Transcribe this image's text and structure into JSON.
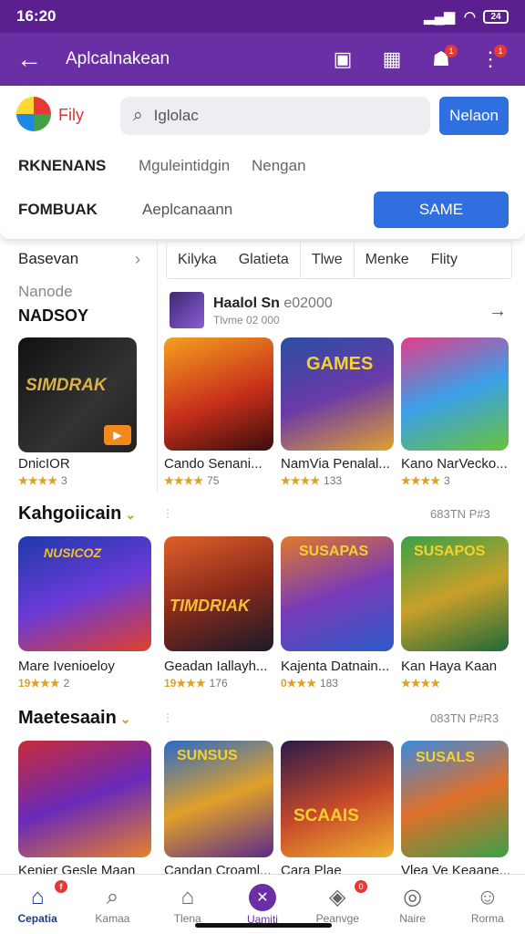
{
  "status": {
    "time": "16:20",
    "battery": "24"
  },
  "appbar": {
    "title": "Aplcalnakean",
    "badge1": "1",
    "badge2": "1"
  },
  "header": {
    "brand": "Fily",
    "search_placeholder": "Iglolac",
    "search_button": "Nelaon",
    "row1_label": "RKNENANS",
    "row1_text": "Mguleintidgin",
    "row1_text2": "Nengan",
    "row2_label": "FOMBUAK",
    "row2_placeholder": "Aeplcanaann",
    "row2_button": "SAME"
  },
  "sidebar": {
    "heading": "Basevan",
    "subtitle": "Nanode",
    "name": "NADSOY",
    "app_label": "DnicIOR",
    "app_rating": "★★★★",
    "app_rating_num": "3",
    "app_banner": "SIMDRAK"
  },
  "tabs": [
    "Kilyka",
    "Glatieta",
    "Tlwe",
    "Menke",
    "Flity"
  ],
  "featured": {
    "title": "Haalol Sn",
    "title2": "e02000",
    "subtitle": "Tlvme 02 000"
  },
  "row1": [
    {
      "label": "Cando Senani...",
      "rating": "★★★★",
      "num": "75",
      "banner": ""
    },
    {
      "label": "NamVia Penalal...",
      "rating": "★★★★",
      "num": "133",
      "banner": "GAMES"
    },
    {
      "label": "Kano NarVecko...",
      "rating": "★★★★",
      "num": "3",
      "banner": ""
    }
  ],
  "sections": [
    {
      "title": "Kahgoiicain",
      "right": "683TN  P#3"
    },
    {
      "title": "Maetesaain",
      "right": "083TN  P#R3"
    }
  ],
  "row2": [
    {
      "label": "Mare Ivenioeloy",
      "rating": "19★★★",
      "num": "2",
      "banner": "NUSICOZ"
    },
    {
      "label": "Geadan Iallayh...",
      "rating": "19★★★",
      "num": "176",
      "banner": "TIMDRIAK"
    },
    {
      "label": "Kajenta Datnain...",
      "rating": "0★★★",
      "num": "183",
      "banner": "SUSAPAS"
    },
    {
      "label": "Kan Haya Kaan",
      "rating": "★★★★",
      "num": "",
      "banner": "SUSAPOS"
    }
  ],
  "row3": [
    {
      "label": "Kenier Gesle Maan",
      "banner": ""
    },
    {
      "label": "Candan Croaml...",
      "banner": "SUNSUS"
    },
    {
      "label": "Cara Plae",
      "banner": "SCAAIS"
    },
    {
      "label": "Vlea Ve Keaane...",
      "banner": "SUSALS"
    }
  ],
  "tabbar": [
    {
      "label": "Cepatia",
      "icon": "home-icon"
    },
    {
      "label": "Kamaa",
      "icon": "search-icon"
    },
    {
      "label": "Tlena",
      "icon": "store-icon"
    },
    {
      "label": "Uamiti",
      "icon": "game-icon"
    },
    {
      "label": "Peanvge",
      "icon": "shield-icon",
      "badge": "0"
    },
    {
      "label": "Naire",
      "icon": "compass-icon"
    },
    {
      "label": "Rorma",
      "icon": "profile-icon"
    }
  ],
  "tabbar_home_badge": "f"
}
